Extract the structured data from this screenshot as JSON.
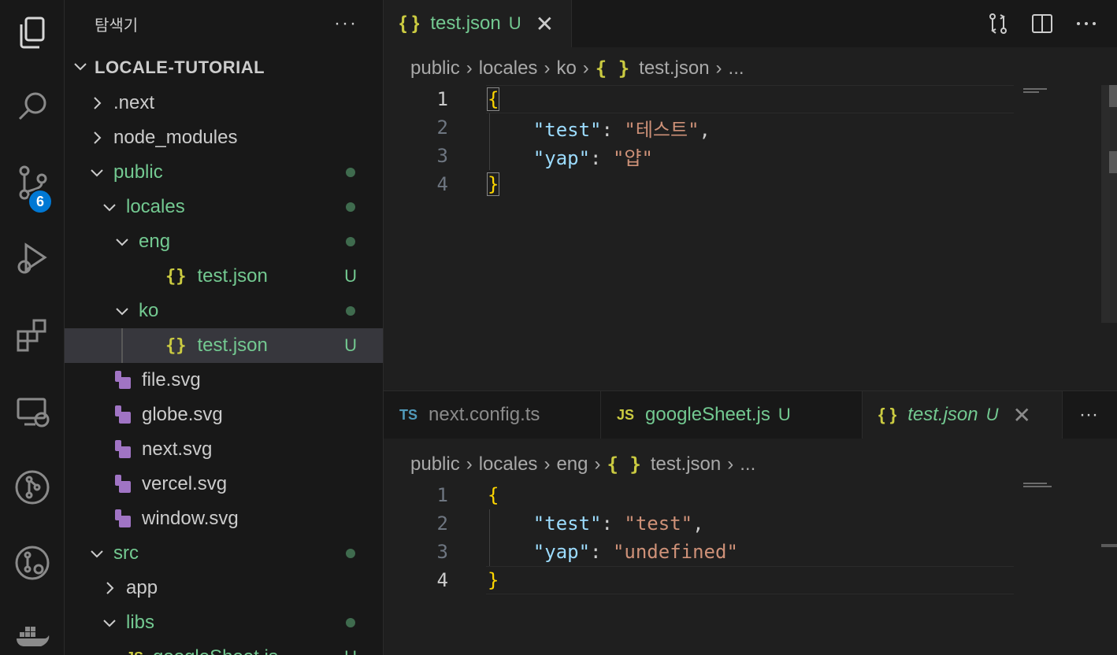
{
  "activity_bar": {
    "items": [
      {
        "icon": "explorer-icon"
      },
      {
        "icon": "search-icon"
      },
      {
        "icon": "source-control-icon",
        "badge": "6"
      },
      {
        "icon": "run-debug-icon"
      },
      {
        "icon": "extensions-icon"
      },
      {
        "icon": "remote-explorer-icon"
      },
      {
        "icon": "git-graph-icon"
      },
      {
        "icon": "gitlens-icon"
      },
      {
        "icon": "docker-icon"
      }
    ]
  },
  "sidebar": {
    "title": "탐색기",
    "more": "···",
    "project": "LOCALE-TUTORIAL",
    "tree": [
      {
        "label": ".next",
        "kind": "folder",
        "open": false,
        "depth": 1
      },
      {
        "label": "node_modules",
        "kind": "folder",
        "open": false,
        "depth": 1
      },
      {
        "label": "public",
        "kind": "folder",
        "open": true,
        "depth": 1,
        "status": "dot"
      },
      {
        "label": "locales",
        "kind": "folder",
        "open": true,
        "depth": 2,
        "status": "dot"
      },
      {
        "label": "eng",
        "kind": "folder",
        "open": true,
        "depth": 3,
        "status": "dot"
      },
      {
        "label": "test.json",
        "kind": "json",
        "depth": 4,
        "status": "U"
      },
      {
        "label": "ko",
        "kind": "folder",
        "open": true,
        "depth": 3,
        "status": "dot"
      },
      {
        "label": "test.json",
        "kind": "json",
        "depth": 4,
        "status": "U",
        "selected": true
      },
      {
        "label": "file.svg",
        "kind": "svg",
        "depth": 2
      },
      {
        "label": "globe.svg",
        "kind": "svg",
        "depth": 2
      },
      {
        "label": "next.svg",
        "kind": "svg",
        "depth": 2
      },
      {
        "label": "vercel.svg",
        "kind": "svg",
        "depth": 2
      },
      {
        "label": "window.svg",
        "kind": "svg",
        "depth": 2
      },
      {
        "label": "src",
        "kind": "folder",
        "open": true,
        "depth": 1,
        "status": "dot"
      },
      {
        "label": "app",
        "kind": "folder",
        "open": false,
        "depth": 2
      },
      {
        "label": "libs",
        "kind": "folder",
        "open": true,
        "depth": 2,
        "status": "dot"
      },
      {
        "label": "googleSheet.js",
        "kind": "js",
        "depth": 3,
        "status": "U"
      }
    ]
  },
  "editor_top": {
    "tab": {
      "icon": "{ }",
      "label": "test.json",
      "status": "U",
      "close": "✕"
    },
    "breadcrumb": [
      "public",
      "locales",
      "ko",
      "test.json",
      "..."
    ],
    "lines": [
      {
        "num": "1",
        "current": true
      },
      {
        "num": "2",
        "key": "\"test\"",
        "value": "\"테스트\"",
        "comma": ","
      },
      {
        "num": "3",
        "key": "\"yap\"",
        "value": "\"얍\"",
        "comma": ""
      },
      {
        "num": "4"
      }
    ]
  },
  "editor_bottom": {
    "tabs": [
      {
        "icon": "TS",
        "label": "next.config.ts",
        "status": ""
      },
      {
        "icon": "JS",
        "label": "googleSheet.js",
        "status": "U"
      },
      {
        "icon": "{ }",
        "label": "test.json",
        "status": "U",
        "close": "✕",
        "active": true
      }
    ],
    "more": "···",
    "breadcrumb": [
      "public",
      "locales",
      "eng",
      "test.json",
      "..."
    ],
    "lines": [
      {
        "num": "1"
      },
      {
        "num": "2",
        "key": "\"test\"",
        "value": "\"test\"",
        "comma": ","
      },
      {
        "num": "3",
        "key": "\"yap\"",
        "value": "\"undefined\"",
        "comma": ""
      },
      {
        "num": "4",
        "current": true
      }
    ]
  },
  "colors": {
    "accent": "#0078d4",
    "untracked": "#73c991",
    "json_icon": "#cbcb41",
    "svg_icon": "#a074c4",
    "brace": "#ffd700",
    "key": "#9cdcfe",
    "string": "#ce9178"
  }
}
